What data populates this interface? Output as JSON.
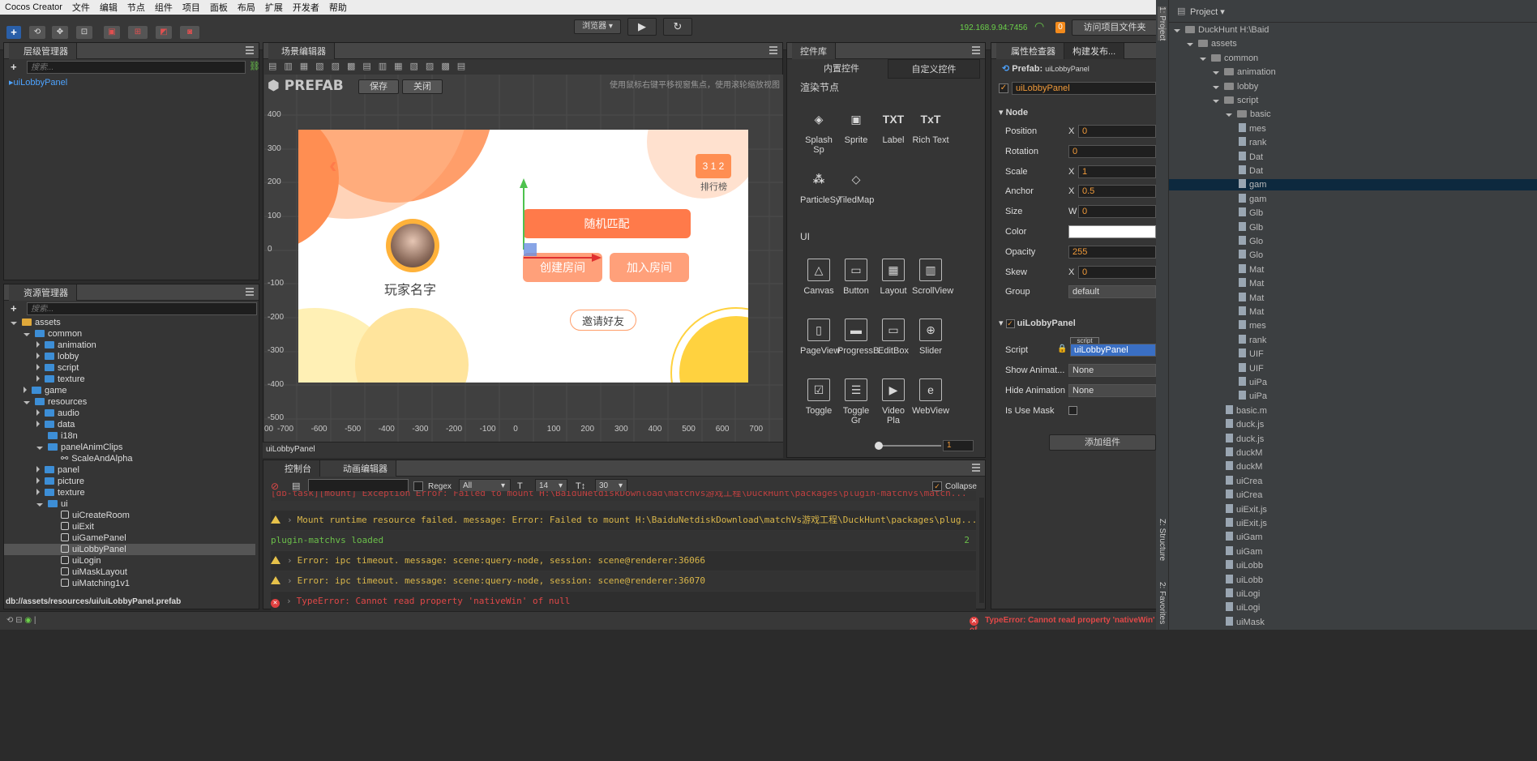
{
  "menu": [
    "Cocos Creator",
    "文件",
    "编辑",
    "节点",
    "组件",
    "项目",
    "面板",
    "布局",
    "扩展",
    "开发者",
    "帮助"
  ],
  "toolbar": {
    "browser_label": "浏览器 ▾",
    "ip": "192.168.9.94:7456",
    "badge": "0",
    "visit_folder": "访问项目文件夹"
  },
  "hierarchy": {
    "title": "层级管理器",
    "search_placeholder": "搜索...",
    "root": "uiLobbyPanel"
  },
  "assets": {
    "title": "资源管理器",
    "search_placeholder": "搜索...",
    "rows": [
      {
        "label": "assets",
        "depth": 0,
        "open": true,
        "kind": "root"
      },
      {
        "label": "common",
        "depth": 1,
        "open": true,
        "kind": "folder"
      },
      {
        "label": "animation",
        "depth": 2,
        "open": false,
        "kind": "folder"
      },
      {
        "label": "lobby",
        "depth": 2,
        "open": false,
        "kind": "folder"
      },
      {
        "label": "script",
        "depth": 2,
        "open": false,
        "kind": "folder"
      },
      {
        "label": "texture",
        "depth": 2,
        "open": false,
        "kind": "folder"
      },
      {
        "label": "game",
        "depth": 1,
        "open": false,
        "kind": "folder"
      },
      {
        "label": "resources",
        "depth": 1,
        "open": true,
        "kind": "folder"
      },
      {
        "label": "audio",
        "depth": 2,
        "open": false,
        "kind": "folder"
      },
      {
        "label": "data",
        "depth": 2,
        "open": false,
        "kind": "folder"
      },
      {
        "label": "i18n",
        "depth": 2,
        "open": null,
        "kind": "folder"
      },
      {
        "label": "panelAnimClips",
        "depth": 2,
        "open": true,
        "kind": "folder"
      },
      {
        "label": "ScaleAndAlpha",
        "depth": 3,
        "open": null,
        "kind": "anim"
      },
      {
        "label": "panel",
        "depth": 2,
        "open": false,
        "kind": "folder"
      },
      {
        "label": "picture",
        "depth": 2,
        "open": false,
        "kind": "folder"
      },
      {
        "label": "texture",
        "depth": 2,
        "open": false,
        "kind": "folder"
      },
      {
        "label": "ui",
        "depth": 2,
        "open": true,
        "kind": "folder"
      },
      {
        "label": "uiCreateRoom",
        "depth": 3,
        "open": null,
        "kind": "prefab"
      },
      {
        "label": "uiExit",
        "depth": 3,
        "open": null,
        "kind": "prefab"
      },
      {
        "label": "uiGamePanel",
        "depth": 3,
        "open": null,
        "kind": "prefab"
      },
      {
        "label": "uiLobbyPanel",
        "depth": 3,
        "open": null,
        "kind": "prefab",
        "selected": true
      },
      {
        "label": "uiLogin",
        "depth": 3,
        "open": null,
        "kind": "prefab"
      },
      {
        "label": "uiMaskLayout",
        "depth": 3,
        "open": null,
        "kind": "prefab"
      },
      {
        "label": "uiMatching1v1",
        "depth": 3,
        "open": null,
        "kind": "prefab"
      }
    ],
    "path": "db://assets/resources/ui/uiLobbyPanel.prefab"
  },
  "scene": {
    "title": "场景编辑器",
    "prefab_label": "PREFAB",
    "save": "保存",
    "close": "关闭",
    "hint": "使用鼠标右键平移视窗焦点，使用滚轮缩放视图",
    "y_ticks": [
      "400",
      "300",
      "200",
      "100",
      "0",
      "-100",
      "-200",
      "-300",
      "-400",
      "-500"
    ],
    "x_ticks": [
      "00",
      "-700",
      "-600",
      "-500",
      "-400",
      "-300",
      "-200",
      "-100",
      "0",
      "100",
      "200",
      "300",
      "400",
      "500",
      "600",
      "700"
    ],
    "footer": "uiLobbyPanel",
    "game": {
      "random_match": "随机匹配",
      "create_room": "创建房间",
      "join_room": "加入房间",
      "invite": "邀请好友",
      "player_name": "玩家名字",
      "rank": "排行榜"
    }
  },
  "controls": {
    "title": "控件库",
    "tab_builtin": "内置控件",
    "tab_custom": "自定义控件",
    "section_render": "渲染节点",
    "section_ui": "UI",
    "render_items": [
      "Splash Sp",
      "Sprite",
      "Label",
      "Rich Text",
      "ParticleSy",
      "TiledMap"
    ],
    "ui_items": [
      "Canvas",
      "Button",
      "Layout",
      "ScrollView",
      "PageView",
      "ProgressB",
      "EditBox",
      "Slider",
      "Toggle",
      "Toggle Gr",
      "Video Pla",
      "WebView"
    ],
    "zoom_value": "1"
  },
  "inspector": {
    "title": "属性检查器",
    "tab2": "构建发布...",
    "prefab_label": "Prefab:",
    "prefab_name": "uiLobbyPanel",
    "node_name": "uiLobbyPanel",
    "node_section": "Node",
    "props": [
      {
        "label": "Position",
        "axis": "X",
        "value": "0"
      },
      {
        "label": "Rotation",
        "axis": "",
        "value": "0"
      },
      {
        "label": "Scale",
        "axis": "X",
        "value": "1"
      },
      {
        "label": "Anchor",
        "axis": "X",
        "value": "0.5"
      },
      {
        "label": "Size",
        "axis": "W",
        "value": "0"
      },
      {
        "label": "Color",
        "axis": "",
        "value": ""
      },
      {
        "label": "Opacity",
        "axis": "",
        "value": "255"
      },
      {
        "label": "Skew",
        "axis": "X",
        "value": "0"
      },
      {
        "label": "Group",
        "axis": "",
        "value": "default"
      }
    ],
    "component": "uiLobbyPanel",
    "script_tag": "script",
    "comp_props": [
      {
        "label": "Script",
        "value": "uiLobbyPanel"
      },
      {
        "label": "Show Animat...",
        "value": "None"
      },
      {
        "label": "Hide Animation",
        "value": "None"
      },
      {
        "label": "Is Use Mask",
        "value": ""
      }
    ],
    "add_component": "添加组件"
  },
  "console": {
    "tab_console": "控制台",
    "tab_anim": "动画编辑器",
    "regex": "Regex",
    "level": "All",
    "font_size": "14",
    "line_height": "30",
    "collapse": "Collapse",
    "lines": [
      {
        "type": "cut",
        "text": "[db-task][mount] Exception Error: Failed to mount H:\\BaiduNetdiskDownload\\matchvs游戏工程\\DuckHunt\\packages\\plugin-matchvs\\match...",
        "color": "#c04040"
      },
      {
        "type": "warn",
        "text": "Mount runtime resource failed. message: Error: Failed to mount H:\\BaiduNetdiskDownload\\matchVs游戏工程\\DuckHunt\\packages\\plug...",
        "color": "#d9b64a"
      },
      {
        "type": "log",
        "text": "plugin-matchvs loaded",
        "color": "#6bbf4a",
        "count": "2"
      },
      {
        "type": "warn",
        "text": "Error: ipc timeout. message: scene:query-node, session: scene@renderer:36066",
        "color": "#d9b64a"
      },
      {
        "type": "warn",
        "text": "Error: ipc timeout. message: scene:query-node, session: scene@renderer:36070",
        "color": "#d9b64a"
      },
      {
        "type": "err",
        "text": "TypeError: Cannot read property 'nativeWin' of null",
        "color": "#e04848"
      }
    ]
  },
  "statusbar": {
    "error": "TypeError: Cannot read property 'nativeWin' of"
  },
  "ide": {
    "project_label": "Project ▾",
    "side_project": "1: Project",
    "side_structure": "Z: Structure",
    "side_favorites": "2: Favorites",
    "rows": [
      {
        "label": "DuckHunt  H:\\Baid",
        "depth": 0
      },
      {
        "label": "assets",
        "depth": 1
      },
      {
        "label": "common",
        "depth": 2
      },
      {
        "label": "animation",
        "depth": 3
      },
      {
        "label": "lobby",
        "depth": 3
      },
      {
        "label": "script",
        "depth": 3
      },
      {
        "label": "basic",
        "depth": 4
      },
      {
        "label": "mes",
        "depth": 5
      },
      {
        "label": "rank",
        "depth": 5
      },
      {
        "label": "Dat",
        "depth": 5
      },
      {
        "label": "Dat",
        "depth": 5
      },
      {
        "label": "gam",
        "depth": 5,
        "selected": true
      },
      {
        "label": "gam",
        "depth": 5
      },
      {
        "label": "Glb",
        "depth": 5
      },
      {
        "label": "Glb",
        "depth": 5
      },
      {
        "label": "Glo",
        "depth": 5
      },
      {
        "label": "Glo",
        "depth": 5
      },
      {
        "label": "Mat",
        "depth": 5
      },
      {
        "label": "Mat",
        "depth": 5
      },
      {
        "label": "Mat",
        "depth": 5
      },
      {
        "label": "Mat",
        "depth": 5
      },
      {
        "label": "mes",
        "depth": 5
      },
      {
        "label": "rank",
        "depth": 5
      },
      {
        "label": "UIF",
        "depth": 5
      },
      {
        "label": "UIF",
        "depth": 5
      },
      {
        "label": "uiPa",
        "depth": 5
      },
      {
        "label": "uiPa",
        "depth": 5
      },
      {
        "label": "basic.m",
        "depth": 4
      },
      {
        "label": "duck.js",
        "depth": 4
      },
      {
        "label": "duck.js",
        "depth": 4
      },
      {
        "label": "duckM",
        "depth": 4
      },
      {
        "label": "duckM",
        "depth": 4
      },
      {
        "label": "uiCrea",
        "depth": 4
      },
      {
        "label": "uiCrea",
        "depth": 4
      },
      {
        "label": "uiExit.js",
        "depth": 4
      },
      {
        "label": "uiExit.js",
        "depth": 4
      },
      {
        "label": "uiGam",
        "depth": 4
      },
      {
        "label": "uiGam",
        "depth": 4
      },
      {
        "label": "uiLobb",
        "depth": 4
      },
      {
        "label": "uiLobb",
        "depth": 4
      },
      {
        "label": "uiLogi",
        "depth": 4
      },
      {
        "label": "uiLogi",
        "depth": 4
      },
      {
        "label": "uiMask",
        "depth": 4
      }
    ]
  }
}
